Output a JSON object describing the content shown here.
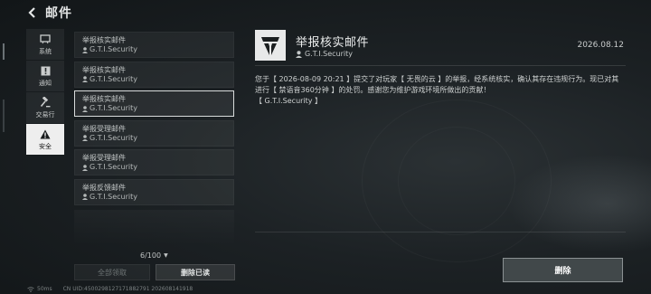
{
  "header": {
    "title": "邮件"
  },
  "sidebar": {
    "items": [
      {
        "label": "系统",
        "icon": "monitor-icon"
      },
      {
        "label": "通知",
        "icon": "notice-icon"
      },
      {
        "label": "交易行",
        "icon": "gavel-icon"
      },
      {
        "label": "安全",
        "icon": "warning-icon",
        "active": true
      }
    ]
  },
  "mail_list": {
    "items": [
      {
        "subject": "举报核实邮件",
        "sender": "G.T.I.Security"
      },
      {
        "subject": "举报核实邮件",
        "sender": "G.T.I.Security"
      },
      {
        "subject": "举报核实邮件",
        "sender": "G.T.I.Security",
        "selected": true
      },
      {
        "subject": "举报受理邮件",
        "sender": "G.T.I.Security"
      },
      {
        "subject": "举报受理邮件",
        "sender": "G.T.I.Security"
      },
      {
        "subject": "举报反馈邮件",
        "sender": "G.T.I.Security"
      }
    ],
    "count": "6/100",
    "claim_all_label": "全部领取",
    "delete_read_label": "删除已读"
  },
  "status": {
    "ping": "50ms",
    "uid": "CN UID:4500298127171882791 20260814191​8"
  },
  "detail": {
    "title": "举报核实邮件",
    "sender": "G.T.I.Security",
    "date": "2026.08.12",
    "body": "您于【 2026-08-09 20:21 】提交了对玩家【 无畏的云 】的举报，经系统核实，确认其存在违规行为。现已对其进行【 禁语音360分钟 】的处罚。感谢您为维护游戏环境所做出的贡献！",
    "signature": "【 G.T.I.Security 】",
    "delete_label": "删除"
  },
  "colors": {
    "accent": "#e8e9e9",
    "background": "#1c2124"
  }
}
